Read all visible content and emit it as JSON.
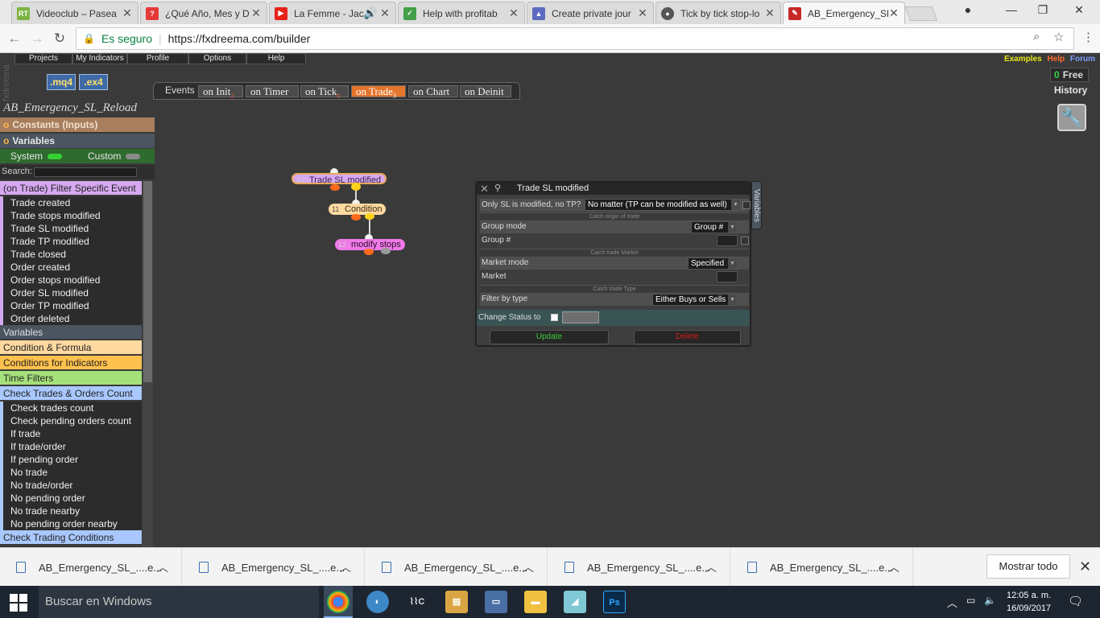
{
  "browser": {
    "tabs": [
      {
        "title": "Videoclub – Pasea",
        "icon": "rt-icon",
        "color": "#7cb342",
        "active": false
      },
      {
        "title": "¿Qué Año, Mes y D",
        "icon": "unknown-site-icon",
        "color": "#e53935",
        "active": false
      },
      {
        "title": "La Femme - Jac",
        "icon": "youtube-icon",
        "color": "#e62117",
        "active": false
      },
      {
        "title": "Help with profitab",
        "icon": "forum-icon",
        "color": "#43a047",
        "active": false
      },
      {
        "title": "Create private jour",
        "icon": "mortarboard-icon",
        "color": "#5c6bc0",
        "active": false
      },
      {
        "title": "Tick by tick stop-lo",
        "icon": "gear-icon",
        "color": "#555555",
        "active": false
      },
      {
        "title": "AB_Emergency_SL",
        "icon": "fxdreema-icon",
        "color": "#c62828",
        "active": true
      }
    ],
    "secure_label": "Es seguro",
    "url": "https://fxdreema.com/builder"
  },
  "app": {
    "brand": "fxdreema",
    "menu": [
      "Projects",
      "My Indicators",
      "Profile",
      "Options",
      "Help"
    ],
    "file_buttons": [
      ".mq4",
      ".ex4"
    ],
    "top_links": {
      "examples": "Examples",
      "help": "Help",
      "forum": "Forum"
    },
    "plan": {
      "count": "0",
      "label": "Free"
    },
    "history_label": "History",
    "events_label": "Events",
    "event_tabs": [
      {
        "label": "on Init",
        "count": "2",
        "active": false
      },
      {
        "label": "on Timer",
        "count": "",
        "active": false
      },
      {
        "label": "on Tick",
        "count": "6",
        "active": false
      },
      {
        "label": "on Trade",
        "count": "3",
        "active": true
      },
      {
        "label": "on Chart",
        "count": "",
        "active": false
      },
      {
        "label": "on Deinit",
        "count": "",
        "active": false
      }
    ],
    "project_title": "AB_Emergency_SL_Reload"
  },
  "sidebar": {
    "constants_label": "Constants (Inputs)",
    "variables_label": "Variables",
    "system_label": "System",
    "custom_label": "Custom",
    "search_label": "Search:",
    "search_value": "",
    "groups": [
      {
        "title": "(on Trade) Filter Specific Event",
        "color": "#d6a8f0",
        "items": [
          "Trade created",
          "Trade stops modified",
          "Trade SL modified",
          "Trade TP modified",
          "Trade closed",
          "Order created",
          "Order stops modified",
          "Order SL modified",
          "Order TP modified",
          "Order deleted"
        ]
      },
      {
        "title": "Variables",
        "color": "#4a5560",
        "text_color": "#e0e0e0",
        "items": []
      },
      {
        "title": "Condition & Formula",
        "color": "#ffd9a0",
        "items": []
      },
      {
        "title": "Conditions for Indicators",
        "color": "#ffc14d",
        "items": []
      },
      {
        "title": "Time Filters",
        "color": "#a5e07a",
        "items": []
      },
      {
        "title": "Check Trades & Orders Count",
        "color": "#a9c8ff",
        "items": [
          "Check trades count",
          "Check pending orders count",
          "If trade",
          "If trade/order",
          "If pending order",
          "No trade",
          "No trade/order",
          "No pending order",
          "No trade nearby",
          "No pending order nearby"
        ]
      },
      {
        "title": "Check Trading Conditions",
        "color": "#a9c8ff",
        "items": []
      }
    ]
  },
  "canvas": {
    "nodes": [
      {
        "id": "13",
        "label": "Trade SL modified",
        "color": "#d9a8f2"
      },
      {
        "id": "11",
        "label": "Condition",
        "color": "#ffd9a0"
      },
      {
        "id": "12",
        "label": "modify stops",
        "color": "#f07ae8"
      }
    ]
  },
  "dialog": {
    "title": "Trade SL modified",
    "vars_tab": "Variables",
    "only_sl_label": "Only SL is modified, no TP?",
    "only_sl_value": "No matter (TP can be modified as well)",
    "section_origin": "Catch origin of trade",
    "group_mode_label": "Group mode",
    "group_mode_value": "Group #",
    "group_num_label": "Group #",
    "group_num_value": "",
    "section_market": "Catch trade Market",
    "market_mode_label": "Market mode",
    "market_mode_value": "Specified",
    "market_label": "Market",
    "market_value": "",
    "section_type": "Catch trade Type",
    "filter_type_label": "Filter by type",
    "filter_type_value": "Either Buys or Sells",
    "change_status_label": "Change Status to",
    "change_status_value": "",
    "update_label": "Update",
    "delete_label": "Delete"
  },
  "downloads": {
    "items": [
      "AB_Emergency_SL_....e...",
      "AB_Emergency_SL_....e...",
      "AB_Emergency_SL_....e...",
      "AB_Emergency_SL_....e...",
      "AB_Emergency_SL_....e..."
    ],
    "show_all": "Mostrar todo"
  },
  "taskbar": {
    "search_placeholder": "Buscar en Windows",
    "time": "12:05 a. m.",
    "date": "16/09/2017"
  }
}
